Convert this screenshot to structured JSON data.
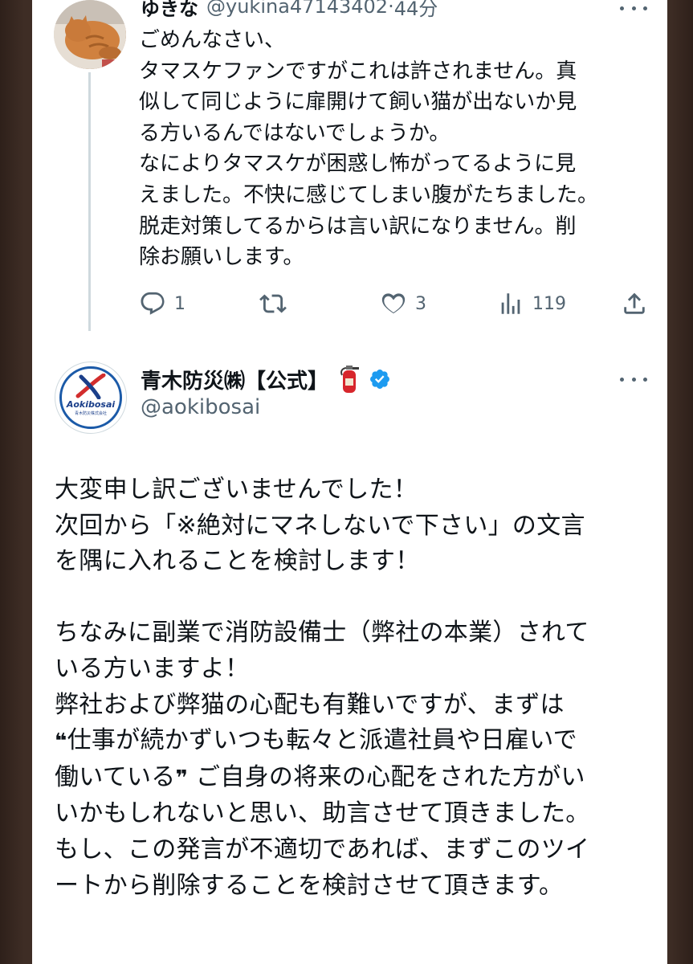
{
  "reply": {
    "author_name": "ゆきな",
    "handle": "@yukina47143402",
    "separator": "·",
    "time": "44分",
    "lines": [
      "ごめんなさい、",
      "タマスケファンですがこれは許されません。真",
      "似して同じように扉開けて飼い猫が出ないか見",
      "る方いるんではないでしょうか。",
      "なによりタマスケが困惑し怖がってるように見",
      "えました。不快に感じてしまい腹がたちました。",
      "脱走対策してるからは言い訳になりません。削",
      "除お願いします。"
    ],
    "actions": {
      "reply_count": "1",
      "retweet_count": "",
      "like_count": "3",
      "view_count": "119"
    }
  },
  "main": {
    "author_name": "青木防災㈱【公式】",
    "handle": "@aokibosai",
    "logo_text": "Aokibosai",
    "logo_subtext": "青木防災株式会社",
    "lines": [
      "大変申し訳ございませんでした！",
      "次回から「※絶対にマネしないで下さい」の文言",
      "を隅に入れることを検討します！",
      "",
      "ちなみに副業で消防設備士（弊社の本業）されて",
      "いる方いますよ！",
      "弊社および弊猫の心配も有難いですが、まずは",
      "仕事が続かずいつも転々と派遣社員や日雇いで",
      "働いている",
      "ご自身の将来の心配をされた方がい",
      "いかもしれないと思い、助言させて頂きました。",
      "もし、この発言が不適切であれば、まずこのツイ",
      "ートから削除することを検討させて頂きます。"
    ],
    "open_quote": "❝",
    "close_quote": "❞"
  },
  "icons": {
    "more": "more-horizontal-icon",
    "reply": "reply-bubble-icon",
    "retweet": "retweet-icon",
    "like": "heart-icon",
    "views": "views-bar-chart-icon",
    "share": "share-upload-icon",
    "extinguisher": "fire-extinguisher-emoji",
    "verified": "verified-badge-icon"
  },
  "colors": {
    "text": "#0f1419",
    "secondary": "#536471",
    "verified": "#1d9bf0",
    "thread_line": "#cfd9de"
  }
}
